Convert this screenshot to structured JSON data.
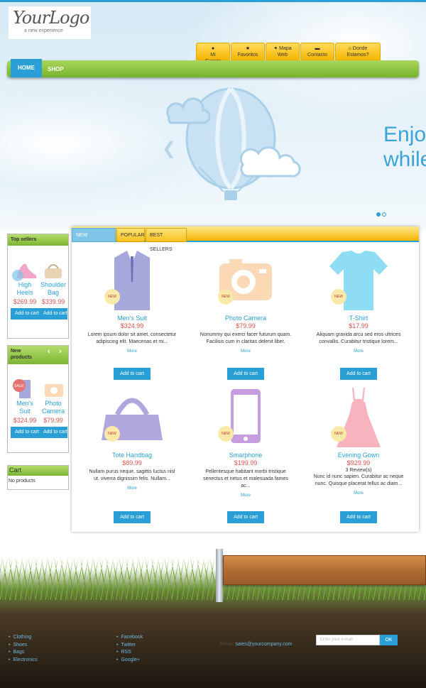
{
  "logo": {
    "brand": "YourLogo",
    "tagline": "a new experience"
  },
  "top_links": [
    {
      "icon": "user-icon",
      "line1": "Mi",
      "line2": "Cuenta"
    },
    {
      "icon": "star-icon",
      "line1": "",
      "line2": "Favoritos"
    },
    {
      "icon": "pin-icon",
      "line1": "Mapa",
      "line2": "Web"
    },
    {
      "icon": "envelope-icon",
      "line1": "",
      "line2": "Contacto"
    },
    {
      "icon": "house-icon",
      "line1": "Donde",
      "line2": "Estamos?"
    }
  ],
  "nav": {
    "home": "HOME",
    "shop": "SHOP"
  },
  "slider": {
    "line1": "Enjoy",
    "line2": "while"
  },
  "top_sellers": {
    "title": "Top sellers",
    "items": [
      {
        "name": "High Heels",
        "price": "$269.99",
        "button": "Add to cart"
      },
      {
        "name": "Shoulder Bag",
        "price": "$339.99",
        "button": "Add to cart"
      }
    ]
  },
  "new_products": {
    "title": "New products",
    "items": [
      {
        "name": "Men's Suit",
        "price": "$324.99",
        "button": "Add to cart",
        "badge": "SALE!"
      },
      {
        "name": "Photo Camera",
        "price": "$79.99",
        "button": "Add to cart",
        "badge": "NEW"
      }
    ]
  },
  "cart": {
    "title": "Cart",
    "empty": "No products"
  },
  "tabs": [
    "NEW ARRIVALS",
    "POPULAR",
    "BEST SELLERS"
  ],
  "products": [
    {
      "name": "Men's Suit",
      "price": "$324.99",
      "desc": "Lorem ipsum dolor sit amet, consectetur adipiscing elit. Maecenas et mi...",
      "more": "More",
      "button": "Add to cart",
      "badge": "NEW",
      "reviews": ""
    },
    {
      "name": "Photo Camera",
      "price": "$79.99",
      "desc": "Nonummy qui exerci facer futurum quam. Facilisis cum in claritas delenit liber.",
      "more": "More",
      "button": "Add to cart",
      "badge": "NEW",
      "reviews": ""
    },
    {
      "name": "T-Shirt",
      "price": "$17.99",
      "desc": "Aliquam gravida arcu sed eros ultrices convallis. Curabitur tristique lorem...",
      "more": "More",
      "button": "Add to cart",
      "badge": "NEW",
      "reviews": ""
    },
    {
      "name": "Tote Handbag",
      "price": "$89.99",
      "desc": "Nullam purus neque, sagittis luctus nisl ut. viverra dignissim felis. Nullam...",
      "more": "More",
      "button": "Add to cart",
      "badge": "NEW",
      "reviews": ""
    },
    {
      "name": "Smarphone",
      "price": "$199.99",
      "desc": "Pellentesque habitant morbi tristique senectus et netus et malesuada fames ac...",
      "more": "More",
      "button": "Add to cart",
      "badge": "NEW",
      "reviews": ""
    },
    {
      "name": "Evening Gown",
      "price": "$929.99",
      "desc": "Nunc id nunc sapien. Curabitur ac neque nunc. Quisque placerat tellus ac diam...",
      "more": "More",
      "button": "Add to cart",
      "badge": "NEW",
      "reviews": "3 Review(s)"
    }
  ],
  "footer": {
    "categories": [
      "Clothing",
      "Shoes",
      "Bags",
      "Electronics"
    ],
    "social": [
      "Facebook",
      "Twitter",
      "RSS",
      "Google+"
    ],
    "contact_label": "Email:",
    "contact_email": "sales@yourcompany.com",
    "newsletter_placeholder": "Enter your e-mail",
    "newsletter_button": "OK"
  }
}
